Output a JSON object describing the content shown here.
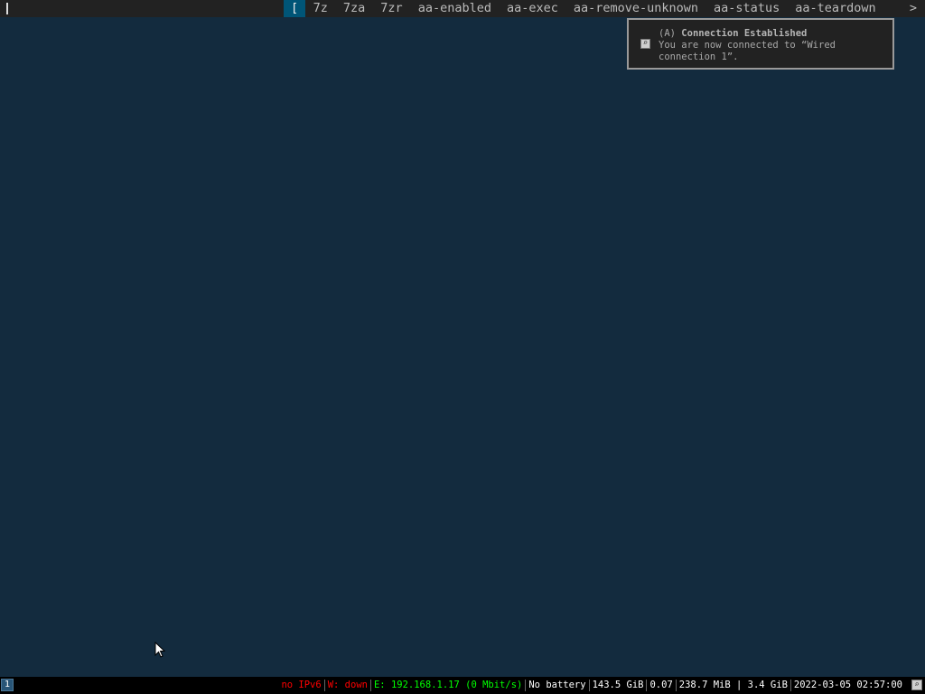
{
  "dmenu": {
    "selected": "[",
    "items": [
      "7z",
      "7za",
      "7zr",
      "aa-enabled",
      "aa-exec",
      "aa-remove-unknown",
      "aa-status",
      "aa-teardown"
    ],
    "more": ">"
  },
  "notification": {
    "app": "(A)",
    "title": "Connection Established",
    "body": "You are now connected to “Wired connection 1”."
  },
  "statusbar": {
    "workspace": "1",
    "ipv6": "no IPv6",
    "wireless": "W: down",
    "ethernet": "E: 192.168.1.17 (0 Mbit/s)",
    "battery": "No battery",
    "disk": "143.5 GiB",
    "load": "0.07",
    "memory": "238.7 MiB | 3.4 GiB",
    "datetime": "2022-03-05 02:57:00"
  }
}
